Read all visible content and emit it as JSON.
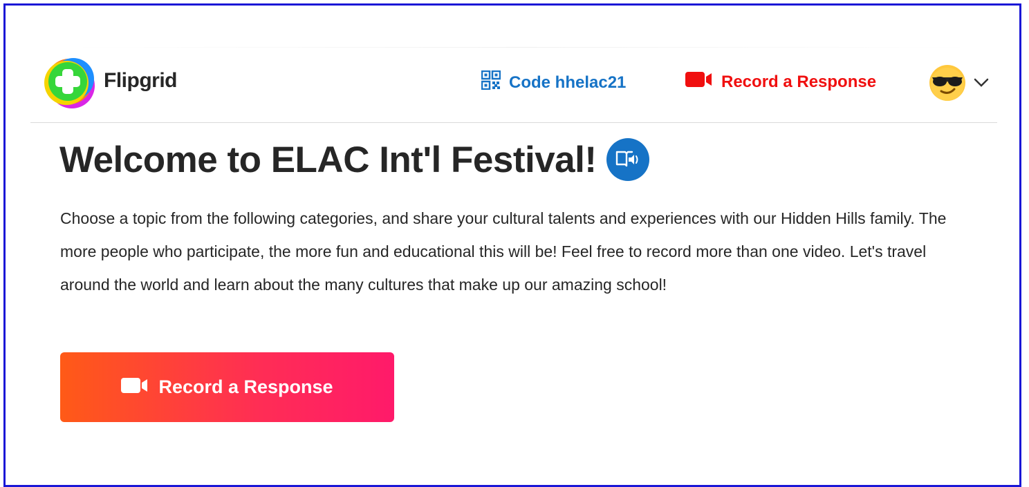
{
  "header": {
    "brand_name": "Flipgrid",
    "code_link_label": "Code hhelac21",
    "record_link_label": "Record a Response",
    "icons": {
      "logo": "flipgrid-logo",
      "code": "qr-code-icon",
      "record": "video-camera-icon",
      "avatar": "sunglasses-emoji-avatar",
      "menu": "chevron-down-icon"
    },
    "colors": {
      "code_link": "#1673c6",
      "record_link": "#f00f0f"
    }
  },
  "main": {
    "title": "Welcome to ELAC Int'l Festival!",
    "immersive_reader_icon": "immersive-reader-icon",
    "description": "Choose a topic from the following categories, and share your cultural talents and experiences with our Hidden Hills family. The more people who participate, the more fun and educational this will be! Feel free to record more than one video. Let's travel around the world and learn about the many cultures that make up our amazing school!",
    "cta_label": "Record a Response",
    "cta_colors": {
      "from": "#ff5a17",
      "to": "#ff1a6a"
    }
  },
  "frame_color": "#1a17d6"
}
